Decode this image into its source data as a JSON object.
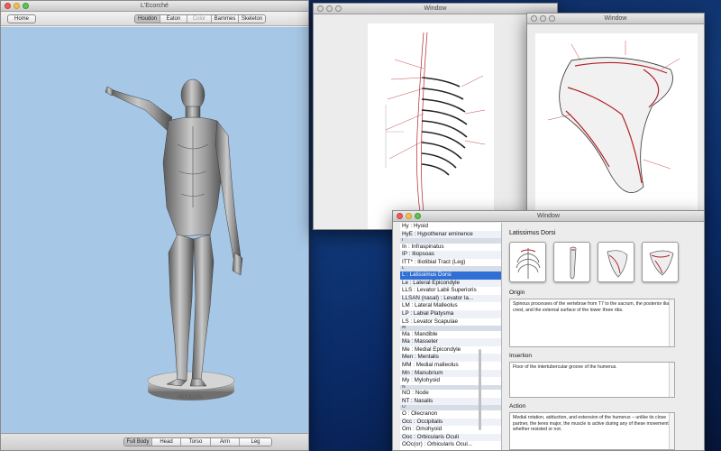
{
  "main_window": {
    "title": "L'Ecorché",
    "home_label": "Home",
    "model_tabs": [
      {
        "label": "Houdon",
        "selected": true,
        "enabled": true
      },
      {
        "label": "Eaton",
        "selected": false,
        "enabled": true
      },
      {
        "label": "Color",
        "selected": false,
        "enabled": false
      },
      {
        "label": "Bammes",
        "selected": false,
        "enabled": true
      },
      {
        "label": "Skeleton",
        "selected": false,
        "enabled": true
      }
    ],
    "view_tabs": [
      {
        "label": "Full Body",
        "selected": true
      },
      {
        "label": "Head",
        "selected": false
      },
      {
        "label": "Torso",
        "selected": false
      },
      {
        "label": "Arm",
        "selected": false
      },
      {
        "label": "Leg",
        "selected": false
      }
    ],
    "pedestal_text": "HOUDON",
    "viewport_color": "#a7c7e6"
  },
  "window_torso": {
    "title": "Window"
  },
  "window_scapula": {
    "title": "Window"
  },
  "info_window": {
    "title": "Window",
    "list": [
      {
        "text": "Hy : Hyoid",
        "type": "item"
      },
      {
        "text": "HyE : Hypothenar eminence",
        "type": "item"
      },
      {
        "text": "I",
        "type": "header"
      },
      {
        "text": "In : Infraspinatus",
        "type": "item"
      },
      {
        "text": "IP : Iliopsoas",
        "type": "item"
      },
      {
        "text": "ITT* : Iliotibial Tract (Leg)",
        "type": "item"
      },
      {
        "text": "L",
        "type": "header"
      },
      {
        "text": "L : Latissimus Dorsi",
        "type": "selected"
      },
      {
        "text": "Le : Lateral Epicondyle",
        "type": "item"
      },
      {
        "text": "LLS : Levator Labii Superioris",
        "type": "item"
      },
      {
        "text": "LLSAN (nasal) : Levator la...",
        "type": "item"
      },
      {
        "text": "LM : Lateral Malleolus",
        "type": "item"
      },
      {
        "text": "LP : Labial Platysma",
        "type": "item"
      },
      {
        "text": "LS : Levator Scapulae",
        "type": "item"
      },
      {
        "text": "M",
        "type": "header"
      },
      {
        "text": "Ma : Mandible",
        "type": "item"
      },
      {
        "text": "Ma : Masseter",
        "type": "item"
      },
      {
        "text": "Me : Medial Epicondyle",
        "type": "item"
      },
      {
        "text": "Men : Mentalis",
        "type": "item"
      },
      {
        "text": "MM : Medial malleolus",
        "type": "item"
      },
      {
        "text": "Mn : Manubrium",
        "type": "item"
      },
      {
        "text": "My : Mylohyoid",
        "type": "item"
      },
      {
        "text": "N",
        "type": "header"
      },
      {
        "text": "NO : Node",
        "type": "item"
      },
      {
        "text": "NT : Nasalis",
        "type": "item"
      },
      {
        "text": "O",
        "type": "header"
      },
      {
        "text": "O : Olecranon",
        "type": "item"
      },
      {
        "text": "Occ : Occipitalis",
        "type": "item"
      },
      {
        "text": "Om : Omohyoid",
        "type": "item"
      },
      {
        "text": "Ooc : Orbicularis Oculi",
        "type": "item"
      },
      {
        "text": "OOc(or) : Orbicularis Ocul...",
        "type": "item"
      }
    ],
    "detail": {
      "title": "Latissimus Dorsi",
      "origin_label": "Origin",
      "origin_text": "Spinous processes of the vertebrae from T7 to the sacrum, the posterior iliac crest, and the external surface of the lower three ribs.",
      "insertion_label": "Insertion",
      "insertion_text": "Floor of the intertubercular groove of the humerus.",
      "action_label": "Action",
      "action_text": "Medial rotation, adduction, and extension of the humerus – unlike its close partner, the teres major, the muscle is active during any of these movements whether resisted or not."
    }
  },
  "colors": {
    "selection": "#2f6fd6",
    "muscle_outline": "#b3212b",
    "desktop": "#123a7a"
  }
}
